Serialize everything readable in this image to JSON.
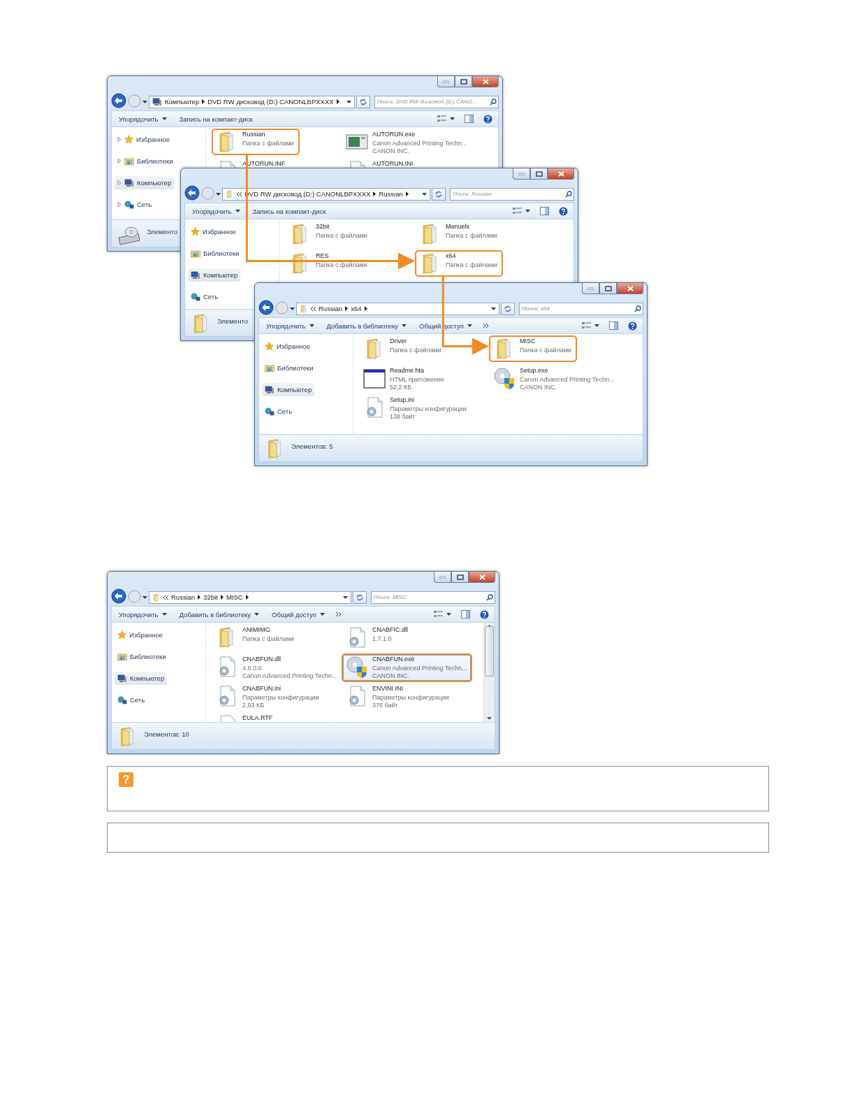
{
  "explorer_windows": [
    {
      "show_expanders": true,
      "address": {
        "kind": "computer",
        "overflow": false,
        "crumbs": [
          "Компьютер",
          "DVD RW дисковод (D:) CANONLBPXXXX"
        ],
        "search_placeholder": "Поиск: DVD RW дисковод (D:) CANO..."
      },
      "toolbar": {
        "buttons": [
          {
            "label": "Упорядочить",
            "dropdown": true
          },
          {
            "label": "Запись на компакт-диск",
            "dropdown": false
          }
        ],
        "more": false
      },
      "sidebar": [
        {
          "kind": "favorites",
          "label": "Избранное",
          "selected": false
        },
        {
          "kind": "libraries",
          "label": "Библиотеки",
          "selected": false
        },
        {
          "kind": "computer",
          "label": "Компьютер",
          "selected": true
        },
        {
          "kind": "network",
          "label": "Сеть",
          "selected": false
        }
      ],
      "items": [
        {
          "kind": "folder",
          "name": "Russian",
          "details": [
            "Папка с файлами"
          ],
          "selected": false,
          "highlighted": true
        },
        {
          "kind": "app",
          "name": "AUTORUN.exe",
          "details": [
            "Canon Advanced Printing Techn...",
            "CANON INC."
          ],
          "selected": false,
          "highlighted": false
        },
        {
          "kind": "settings",
          "name": "AUTORUN.INF",
          "selected": false,
          "highlighted": false
        },
        {
          "kind": "settings",
          "name": "AUTORUN.INI",
          "selected": false,
          "highlighted": false
        }
      ],
      "scrollbar": false,
      "status": {
        "kind": "drive",
        "text": "Элементо"
      }
    },
    {
      "show_expanders": false,
      "address": {
        "kind": "folder",
        "overflow": true,
        "crumbs": [
          "DVD RW дисковод (D:) CANONLBPXXXX",
          "Russian"
        ],
        "search_placeholder": "Поиск: Russian"
      },
      "toolbar": {
        "buttons": [
          {
            "label": "Упорядочить",
            "dropdown": true
          },
          {
            "label": "Запись на компакт-диск",
            "dropdown": false
          }
        ],
        "more": false
      },
      "sidebar": [
        {
          "kind": "favorites",
          "label": "Избранное",
          "selected": false
        },
        {
          "kind": "libraries",
          "label": "Библиотеки",
          "selected": false
        },
        {
          "kind": "computer",
          "label": "Компьютер",
          "selected": true
        },
        {
          "kind": "network",
          "label": "Сеть",
          "selected": false
        }
      ],
      "items": [
        {
          "kind": "folder",
          "name": "32bit",
          "details": [
            "Папка с файлами"
          ],
          "selected": false,
          "highlighted": false
        },
        {
          "kind": "folder",
          "name": "Manuels",
          "details": [
            "Папка с файлами"
          ],
          "selected": false,
          "highlighted": false
        },
        {
          "kind": "folder",
          "name": "RES",
          "details": [
            "Папка с файлами"
          ],
          "selected": false,
          "highlighted": false
        },
        {
          "kind": "folder",
          "name": "x64",
          "details": [
            "Папка с файлами"
          ],
          "selected": false,
          "highlighted": true
        }
      ],
      "scrollbar": false,
      "status": {
        "kind": "folder",
        "text": "Элементо"
      }
    },
    {
      "show_expanders": false,
      "address": {
        "kind": "folder",
        "overflow": true,
        "crumbs": [
          "Russian",
          "x64"
        ],
        "search_placeholder": "Поиск: x64"
      },
      "toolbar": {
        "buttons": [
          {
            "label": "Упорядочить",
            "dropdown": true
          },
          {
            "label": "Добавить в библиотеку",
            "dropdown": true
          },
          {
            "label": "Общий доступ",
            "dropdown": true
          }
        ],
        "more": true
      },
      "sidebar": [
        {
          "kind": "favorites",
          "label": "Избранное",
          "selected": false
        },
        {
          "kind": "libraries",
          "label": "Библиотеки",
          "selected": false
        },
        {
          "kind": "computer",
          "label": "Компьютер",
          "selected": true
        },
        {
          "kind": "network",
          "label": "Сеть",
          "selected": false
        }
      ],
      "items": [
        {
          "kind": "folder",
          "name": "Driver",
          "details": [
            "Папка с файлами"
          ],
          "selected": false,
          "highlighted": false
        },
        {
          "kind": "folder",
          "name": "MISC",
          "details": [
            "Папка с файлами"
          ],
          "selected": false,
          "highlighted": true
        },
        {
          "kind": "window",
          "name": "Readme.hta",
          "details": [
            "HTML приложение",
            "52,2 КБ"
          ],
          "selected": false,
          "highlighted": false
        },
        {
          "kind": "installer",
          "name": "Setup.exe",
          "details": [
            "Canon Advanced Printing Techn...",
            "CANON INC."
          ],
          "selected": false,
          "highlighted": false
        },
        {
          "kind": "settings",
          "name": "Setup.ini",
          "details": [
            "Параметры конфигурации",
            "138 байт"
          ],
          "selected": false,
          "highlighted": false
        }
      ],
      "scrollbar": false,
      "status": {
        "kind": "folder",
        "text": "Элементов: 5"
      }
    },
    {
      "show_expanders": false,
      "address": {
        "kind": "folder",
        "overflow": true,
        "crumbs": [
          "Russian",
          "32bit",
          "MISC"
        ],
        "search_placeholder": "Поиск: MISC"
      },
      "toolbar": {
        "buttons": [
          {
            "label": "Упорядочить",
            "dropdown": true
          },
          {
            "label": "Добавить в библиотеку",
            "dropdown": true
          },
          {
            "label": "Общий доступ",
            "dropdown": true
          }
        ],
        "more": true
      },
      "sidebar": [
        {
          "kind": "favorites",
          "label": "Избранное",
          "selected": false
        },
        {
          "kind": "libraries",
          "label": "Библиотеки",
          "selected": false
        },
        {
          "kind": "computer",
          "label": "Компьютер",
          "selected": true
        },
        {
          "kind": "network",
          "label": "Сеть",
          "selected": false
        }
      ],
      "items": [
        {
          "kind": "folder",
          "name": "ANIMIMG",
          "details": [
            "Папка с файлами"
          ],
          "selected": false,
          "highlighted": false
        },
        {
          "kind": "settings",
          "name": "CNABFIC.dll",
          "details": [
            "1.7.1.0"
          ],
          "selected": false,
          "highlighted": false
        },
        {
          "kind": "settings",
          "name": "CNABFUN.dll",
          "details": [
            "4.8.0.6",
            "Canon Advanced Printing Techn..."
          ],
          "selected": false,
          "highlighted": false
        },
        {
          "kind": "installer",
          "name": "CNABFUN.exe",
          "details": [
            "Canon Advanced Printing Techn...",
            "CANON INC."
          ],
          "selected": true,
          "highlighted": true
        },
        {
          "kind": "settings",
          "name": "CNABFUN.ini",
          "details": [
            "Параметры конфигурации",
            "2,93 КБ"
          ],
          "selected": false,
          "highlighted": false
        },
        {
          "kind": "settings",
          "name": "ENVINI.INI",
          "details": [
            "Параметры конфигурации",
            "376 байт"
          ],
          "selected": false,
          "highlighted": false
        },
        {
          "kind": "document",
          "name": "EULA.RTF",
          "selected": false,
          "highlighted": false
        }
      ],
      "scrollbar": true,
      "status": {
        "kind": "folder",
        "text": "Элементов: 10"
      }
    }
  ],
  "notes": [
    {
      "kind": "question",
      "icon": "?"
    },
    {
      "kind": "plain"
    }
  ]
}
